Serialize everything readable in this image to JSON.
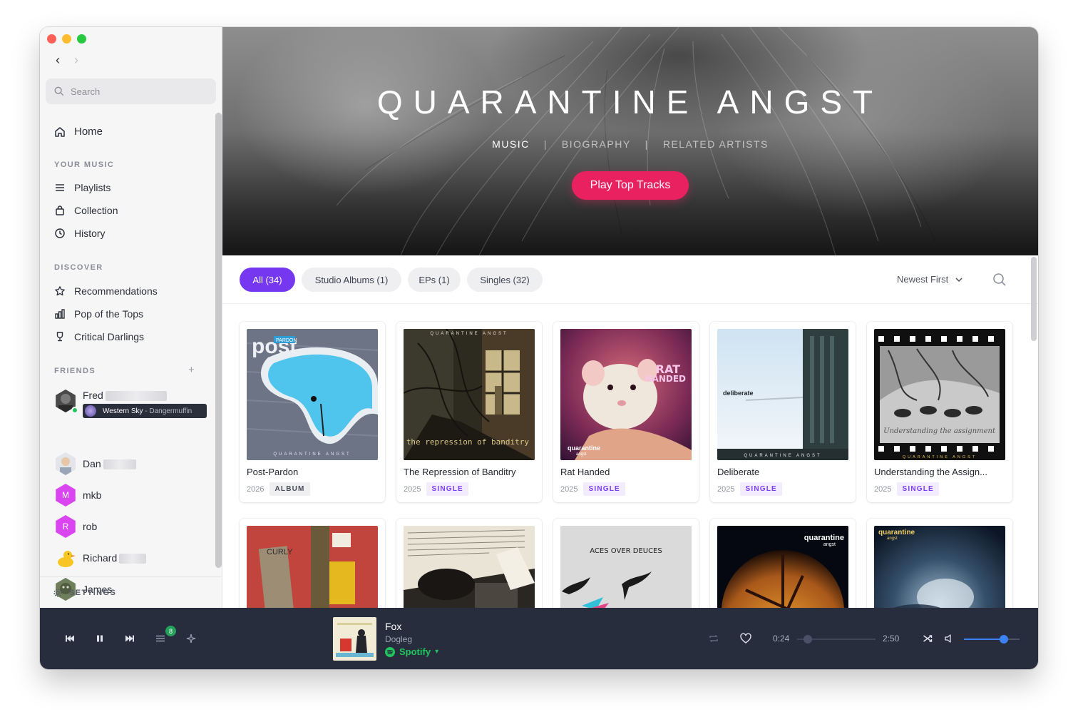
{
  "sidebar": {
    "search_placeholder": "Search",
    "home_label": "Home",
    "your_music_header": "YOUR MUSIC",
    "your_music": [
      {
        "label": "Playlists",
        "icon": "list-icon"
      },
      {
        "label": "Collection",
        "icon": "bag-icon"
      },
      {
        "label": "History",
        "icon": "clock-icon"
      }
    ],
    "discover_header": "DISCOVER",
    "discover": [
      {
        "label": "Recommendations",
        "icon": "star-icon"
      },
      {
        "label": "Pop of the Tops",
        "icon": "bar-chart-icon"
      },
      {
        "label": "Critical Darlings",
        "icon": "trophy-icon"
      }
    ],
    "friends_header": "FRIENDS",
    "friends_add": "+",
    "friends": [
      {
        "name": "Fred",
        "now_playing_track": "Western Sky",
        "now_playing_artist": "- Dangermuffin",
        "online": true
      },
      {
        "name": "Dan"
      },
      {
        "name": "mkb",
        "initial": "M",
        "color": "#d946ef"
      },
      {
        "name": "rob",
        "initial": "R",
        "color": "#d946ef"
      },
      {
        "name": "Richard"
      },
      {
        "name": "James"
      }
    ],
    "settings_label": "SETTINGS"
  },
  "hero": {
    "artist": "QUARANTINE ANGST",
    "tabs": [
      "MUSIC",
      "BIOGRAPHY",
      "RELATED ARTISTS"
    ],
    "active_tab": "MUSIC",
    "tab_separator": "|",
    "play_button": "Play Top Tracks",
    "accent_color": "#ea2161"
  },
  "filters": {
    "chips": [
      {
        "label": "All (34)",
        "active": true
      },
      {
        "label": "Studio Albums (1)"
      },
      {
        "label": "EPs (1)"
      },
      {
        "label": "Singles (32)"
      }
    ],
    "sort_label": "Newest First",
    "accent_color": "#7537ef"
  },
  "releases": [
    {
      "title": "Post-Pardon",
      "year": "2026",
      "type": "ALBUM"
    },
    {
      "title": "The Repression of Banditry",
      "year": "2025",
      "type": "SINGLE"
    },
    {
      "title": "Rat Handed",
      "year": "2025",
      "type": "SINGLE"
    },
    {
      "title": "Deliberate",
      "year": "2025",
      "type": "SINGLE"
    },
    {
      "title": "Understanding the Assign...",
      "year": "2025",
      "type": "SINGLE"
    }
  ],
  "cover_text": {
    "band": "QUARANTINE ANGST",
    "post": "post",
    "pardon": "PARDON",
    "repression": "the repression of banditry",
    "rat": "RAT",
    "handed": "HANDED",
    "quarantine": "quarantine",
    "angst": "angst",
    "deliberate": "deliberate",
    "understanding": "Understanding the assignment",
    "aces": "ACES OVER DEUCES",
    "curly": "CURLY"
  },
  "player": {
    "track": "Fox",
    "artist": "Dogleg",
    "source": "Spotify",
    "elapsed": "0:24",
    "duration": "2:50",
    "queue_count": "8",
    "progress_fraction": 0.14,
    "volume_fraction": 0.72,
    "source_color": "#21c45d"
  }
}
